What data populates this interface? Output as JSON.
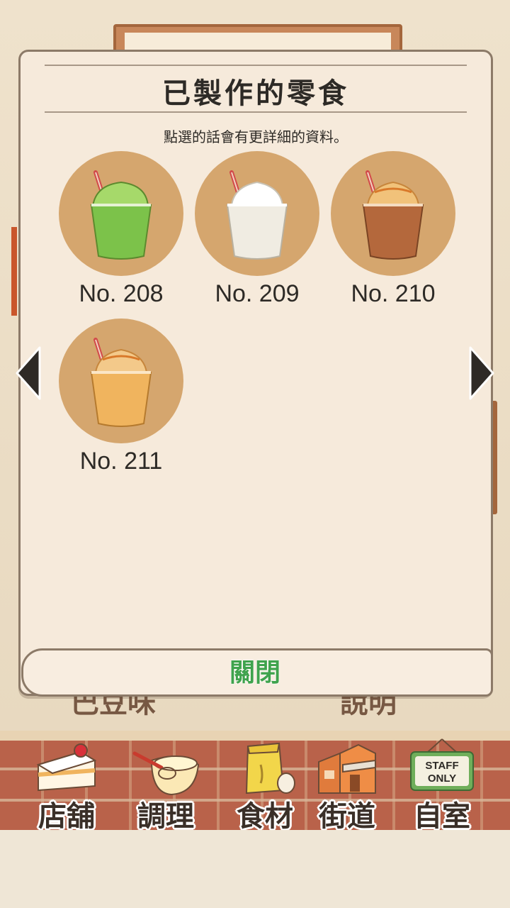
{
  "dialog": {
    "title": "已製作的零食",
    "subtitle": "點選的話會有更詳細的資料。",
    "close_label": "關閉"
  },
  "items": [
    {
      "number": "No. 208",
      "drink": "green-frappe",
      "cup_color": "#7cc24a",
      "top_color": "#a6d96a"
    },
    {
      "number": "No. 209",
      "drink": "white-frappe",
      "cup_color": "#f0ece2",
      "top_color": "#ffffff"
    },
    {
      "number": "No. 210",
      "drink": "caramel-brown-frappe",
      "cup_color": "#b4683c",
      "top_color": "#f1c27a"
    },
    {
      "number": "No. 211",
      "drink": "caramel-orange-frappe",
      "cup_color": "#f0b45e",
      "top_color": "#f3c98a"
    }
  ],
  "toolbar": {
    "items": [
      {
        "label": "店舖",
        "icon": "cake-icon"
      },
      {
        "label": "調理",
        "icon": "whisk-bowl-icon"
      },
      {
        "label": "食材",
        "icon": "flour-bag-icon"
      },
      {
        "label": "街道",
        "icon": "street-shops-icon"
      },
      {
        "label": "自室",
        "icon": "staff-only-sign-icon"
      }
    ],
    "staff_sign_text_1": "STAFF",
    "staff_sign_text_2": "ONLY"
  },
  "background": {
    "left_text": "巴豆味",
    "right_text": "說明"
  }
}
